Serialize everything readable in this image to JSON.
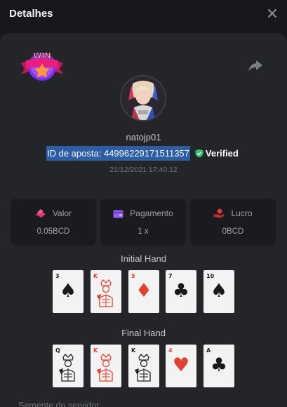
{
  "window": {
    "title": "Detalhes",
    "close_icon": "close-icon"
  },
  "badge": {
    "text": "WIN",
    "colors": {
      "primary": "#e91e80",
      "star": "#ff9a2e",
      "text": "#ffd44d"
    }
  },
  "user": {
    "name": "natojp01"
  },
  "bet": {
    "id_label": "ID de aposta: 449962291715113​57",
    "verified_label": "Verified",
    "date": "21/12/2021 17:40:12"
  },
  "stats": [
    {
      "label": "Valor",
      "value": "0.05BCD",
      "icon": "chip-icon",
      "color": "#e6356e"
    },
    {
      "label": "Pagamento",
      "value": "1 x",
      "icon": "wallet-icon",
      "color": "#9a5cf6"
    },
    {
      "label": "Lucro",
      "value": "0BCD",
      "icon": "profit-hand-icon",
      "color": "#e63838"
    }
  ],
  "initial_hand": {
    "title": "Initial Hand",
    "cards": [
      {
        "rank": "3",
        "suit": "♠",
        "color": "black"
      },
      {
        "rank": "K",
        "suit": "♥",
        "color": "red",
        "face": true
      },
      {
        "rank": "5",
        "suit": "♦",
        "color": "red"
      },
      {
        "rank": "7",
        "suit": "♣",
        "color": "black"
      },
      {
        "rank": "10",
        "suit": "♠",
        "color": "black"
      }
    ]
  },
  "final_hand": {
    "title": "Final Hand",
    "cards": [
      {
        "rank": "Q",
        "suit": "♣",
        "color": "black",
        "face": true
      },
      {
        "rank": "K",
        "suit": "♥",
        "color": "red",
        "face": true
      },
      {
        "rank": "K",
        "suit": "♠",
        "color": "black",
        "face": true
      },
      {
        "rank": "4",
        "suit": "♥",
        "color": "red"
      },
      {
        "rank": "A",
        "suit": "♣",
        "color": "black"
      }
    ]
  },
  "footer": {
    "text": "Semente do servidor"
  }
}
